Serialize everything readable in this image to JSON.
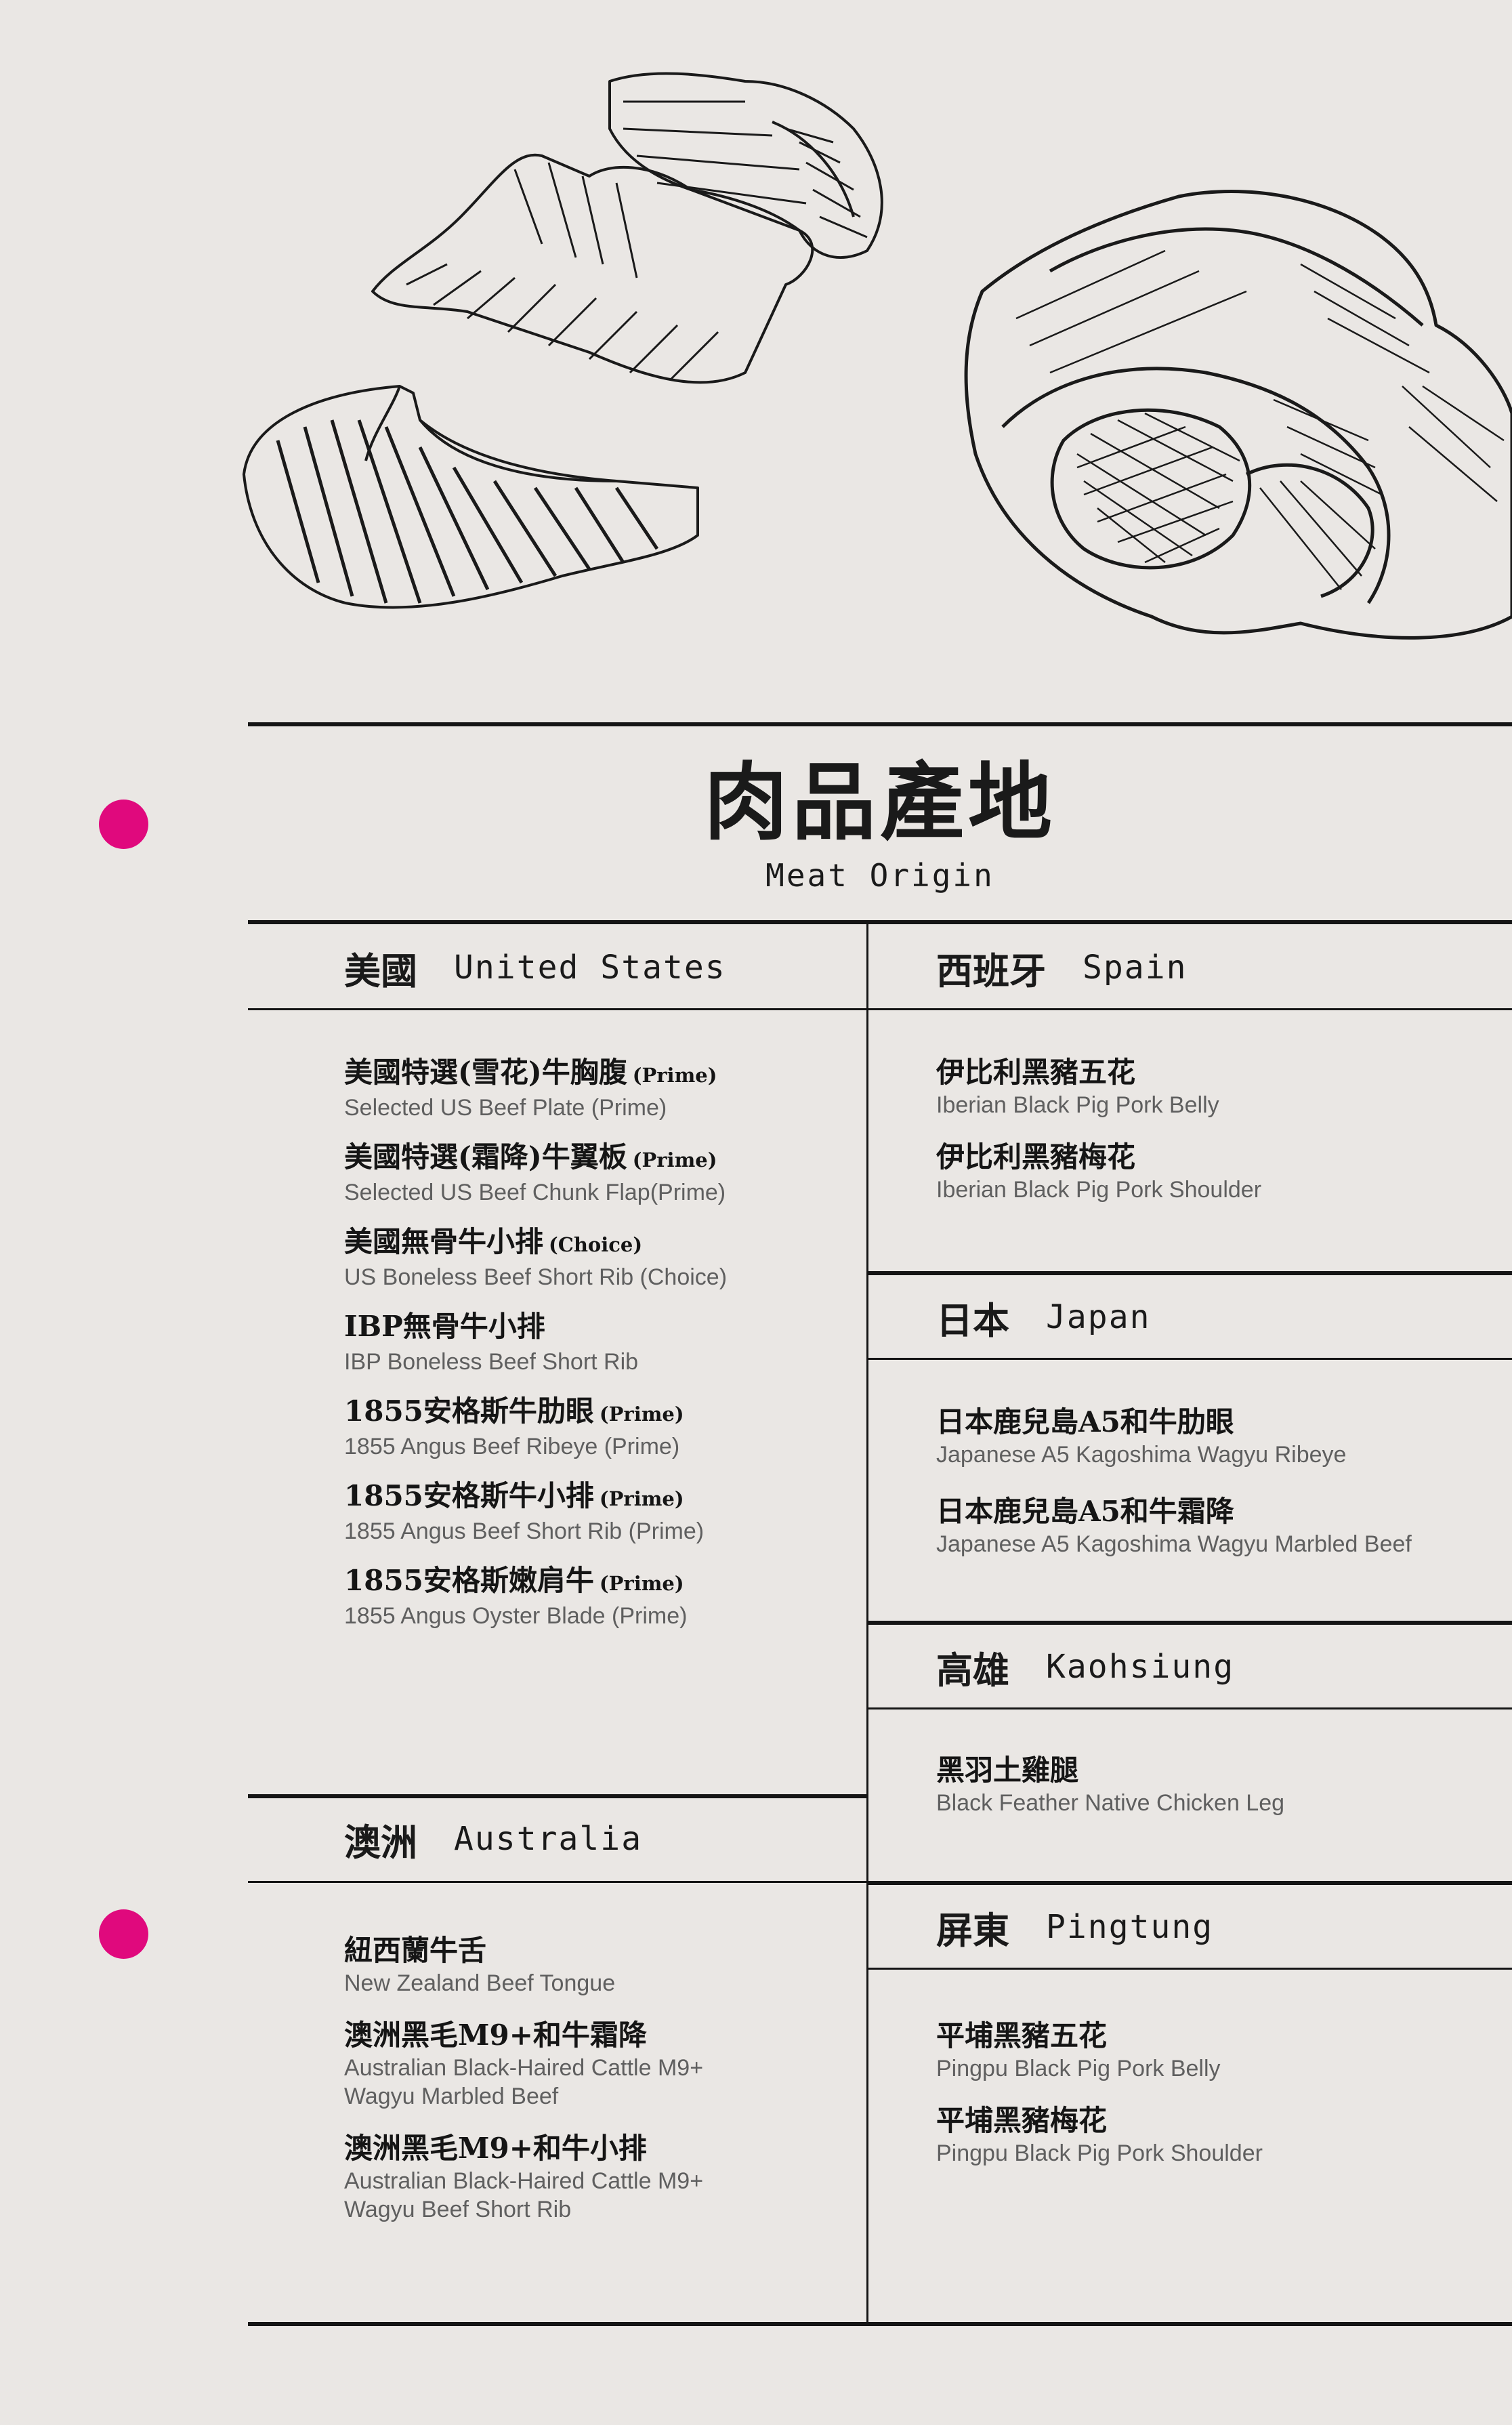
{
  "header": {
    "title_zh": "肉品產地",
    "title_en": "Meat Origin"
  },
  "illustrations": [
    "pork-ribs",
    "lamb-rack",
    "beef-cuts"
  ],
  "colors": {
    "accent": "#e0097d",
    "background": "#eae7e4",
    "ink": "#151515",
    "subtext": "#5f5f5f"
  },
  "sections": {
    "us": {
      "zh": "美國",
      "en": "United States",
      "items": [
        {
          "zh": "美國特選(雪花)牛胸腹",
          "grade": "(Prime)",
          "en": [
            "Selected US Beef Plate (Prime)"
          ]
        },
        {
          "zh": "美國特選(霜降)牛翼板",
          "grade": "(Prime)",
          "en": [
            "Selected US Beef Chunk Flap(Prime)"
          ]
        },
        {
          "zh": "美國無骨牛小排",
          "grade": "(Choice)",
          "en": [
            "US Boneless Beef Short Rib (Choice)"
          ]
        },
        {
          "zh": "IBP無骨牛小排",
          "grade": "",
          "en": [
            "IBP Boneless Beef Short Rib"
          ]
        },
        {
          "zh": "1855安格斯牛肋眼",
          "grade": "(Prime)",
          "en": [
            "1855 Angus Beef Ribeye (Prime)"
          ]
        },
        {
          "zh": "1855安格斯牛小排",
          "grade": "(Prime)",
          "en": [
            "1855 Angus Beef Short Rib (Prime)"
          ]
        },
        {
          "zh": "1855安格斯嫩肩牛",
          "grade": "(Prime)",
          "en": [
            "1855 Angus Oyster Blade (Prime)"
          ]
        }
      ]
    },
    "australia": {
      "zh": "澳洲",
      "en": "Australia",
      "items": [
        {
          "zh": "紐西蘭牛舌",
          "grade": "",
          "en": [
            "New Zealand Beef Tongue"
          ]
        },
        {
          "zh": "澳洲黑毛M9+和牛霜降",
          "grade": "",
          "en": [
            "Australian Black-Haired Cattle M9+",
            "Wagyu Marbled Beef"
          ]
        },
        {
          "zh": "澳洲黑毛M9+和牛小排",
          "grade": "",
          "en": [
            "Australian Black-Haired Cattle M9+",
            "Wagyu Beef Short Rib"
          ]
        }
      ]
    },
    "spain": {
      "zh": "西班牙",
      "en": "Spain",
      "items": [
        {
          "zh": "伊比利黑豬五花",
          "grade": "",
          "en": [
            "Iberian Black Pig Pork Belly"
          ]
        },
        {
          "zh": "伊比利黑豬梅花",
          "grade": "",
          "en": [
            "Iberian Black Pig Pork Shoulder"
          ]
        }
      ]
    },
    "japan": {
      "zh": "日本",
      "en": "Japan",
      "items": [
        {
          "zh": "日本鹿兒島A5和牛肋眼",
          "grade": "",
          "en": [
            "Japanese A5 Kagoshima Wagyu Ribeye"
          ]
        },
        {
          "zh": "日本鹿兒島A5和牛霜降",
          "grade": "",
          "en": [
            "Japanese A5 Kagoshima Wagyu Marbled Beef"
          ]
        }
      ]
    },
    "kaohsiung": {
      "zh": "高雄",
      "en": "Kaohsiung",
      "items": [
        {
          "zh": "黑羽土雞腿",
          "grade": "",
          "en": [
            "Black Feather Native Chicken Leg"
          ]
        }
      ]
    },
    "pingtung": {
      "zh": "屏東",
      "en": "Pingtung",
      "items": [
        {
          "zh": "平埔黑豬五花",
          "grade": "",
          "en": [
            "Pingpu Black Pig Pork Belly"
          ]
        },
        {
          "zh": "平埔黑豬梅花",
          "grade": "",
          "en": [
            "Pingpu Black Pig Pork Shoulder"
          ]
        }
      ]
    }
  }
}
